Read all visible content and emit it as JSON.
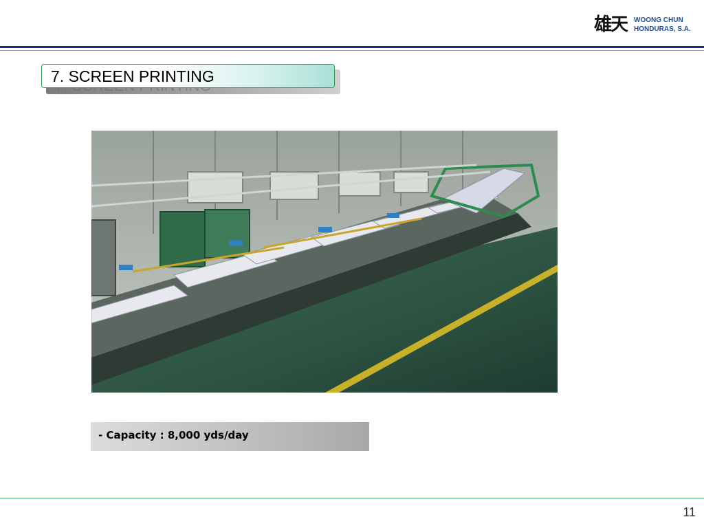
{
  "header": {
    "logo_mark": "雄天",
    "logo_line1": "WOONG CHUN",
    "logo_line2": "HONDURAS, S.A."
  },
  "slide": {
    "title": "7. SCREEN PRINTING",
    "capacity": "- Capacity : 8,000 yds/day",
    "page_number": "11"
  },
  "colors": {
    "header_rule": "#1f2d8f",
    "title_border": "#2f9e5a",
    "footer_rule": "#3aa35c"
  }
}
